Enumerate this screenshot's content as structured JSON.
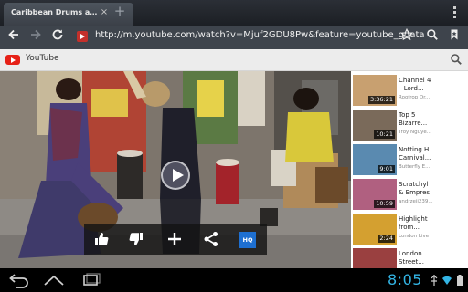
{
  "browser": {
    "tab_title": "Caribbean Drums and Da…",
    "tab_close": "×",
    "tab_new": "+",
    "url": "http://m.youtube.com/watch?v=Mjuf2GDU8Pw&feature=youtube_gdata"
  },
  "youtube": {
    "header_title": "YouTube",
    "hq_label": "HQ"
  },
  "related": [
    {
      "title": "Channel 4\n– Lord...",
      "author": "Roofrop Dr...",
      "duration": "3:36:21",
      "thumb_color": "#c8a070"
    },
    {
      "title": "Top 5\nBizarre...",
      "author": "Troy Nguye...",
      "duration": "10:21",
      "thumb_color": "#7a6a5a"
    },
    {
      "title": "Notting H\nCarnival...",
      "author": "Butterfly E...",
      "duration": "9:01",
      "thumb_color": "#5a8ab0"
    },
    {
      "title": "Scratchyl\n& Empres",
      "author": "andrzejj239...",
      "duration": "10:59",
      "thumb_color": "#b06080"
    },
    {
      "title": "Highlight\nfrom...",
      "author": "London Live",
      "duration": "2:24",
      "thumb_color": "#d4a030"
    },
    {
      "title": "London\nStreet...",
      "author": "",
      "duration": "",
      "thumb_color": "#9a4040"
    }
  ],
  "status": {
    "clock": "8:05"
  },
  "colors": {
    "accent": "#33b5e5",
    "youtube_red": "#e62117",
    "hq_blue": "#1e6fd0"
  }
}
